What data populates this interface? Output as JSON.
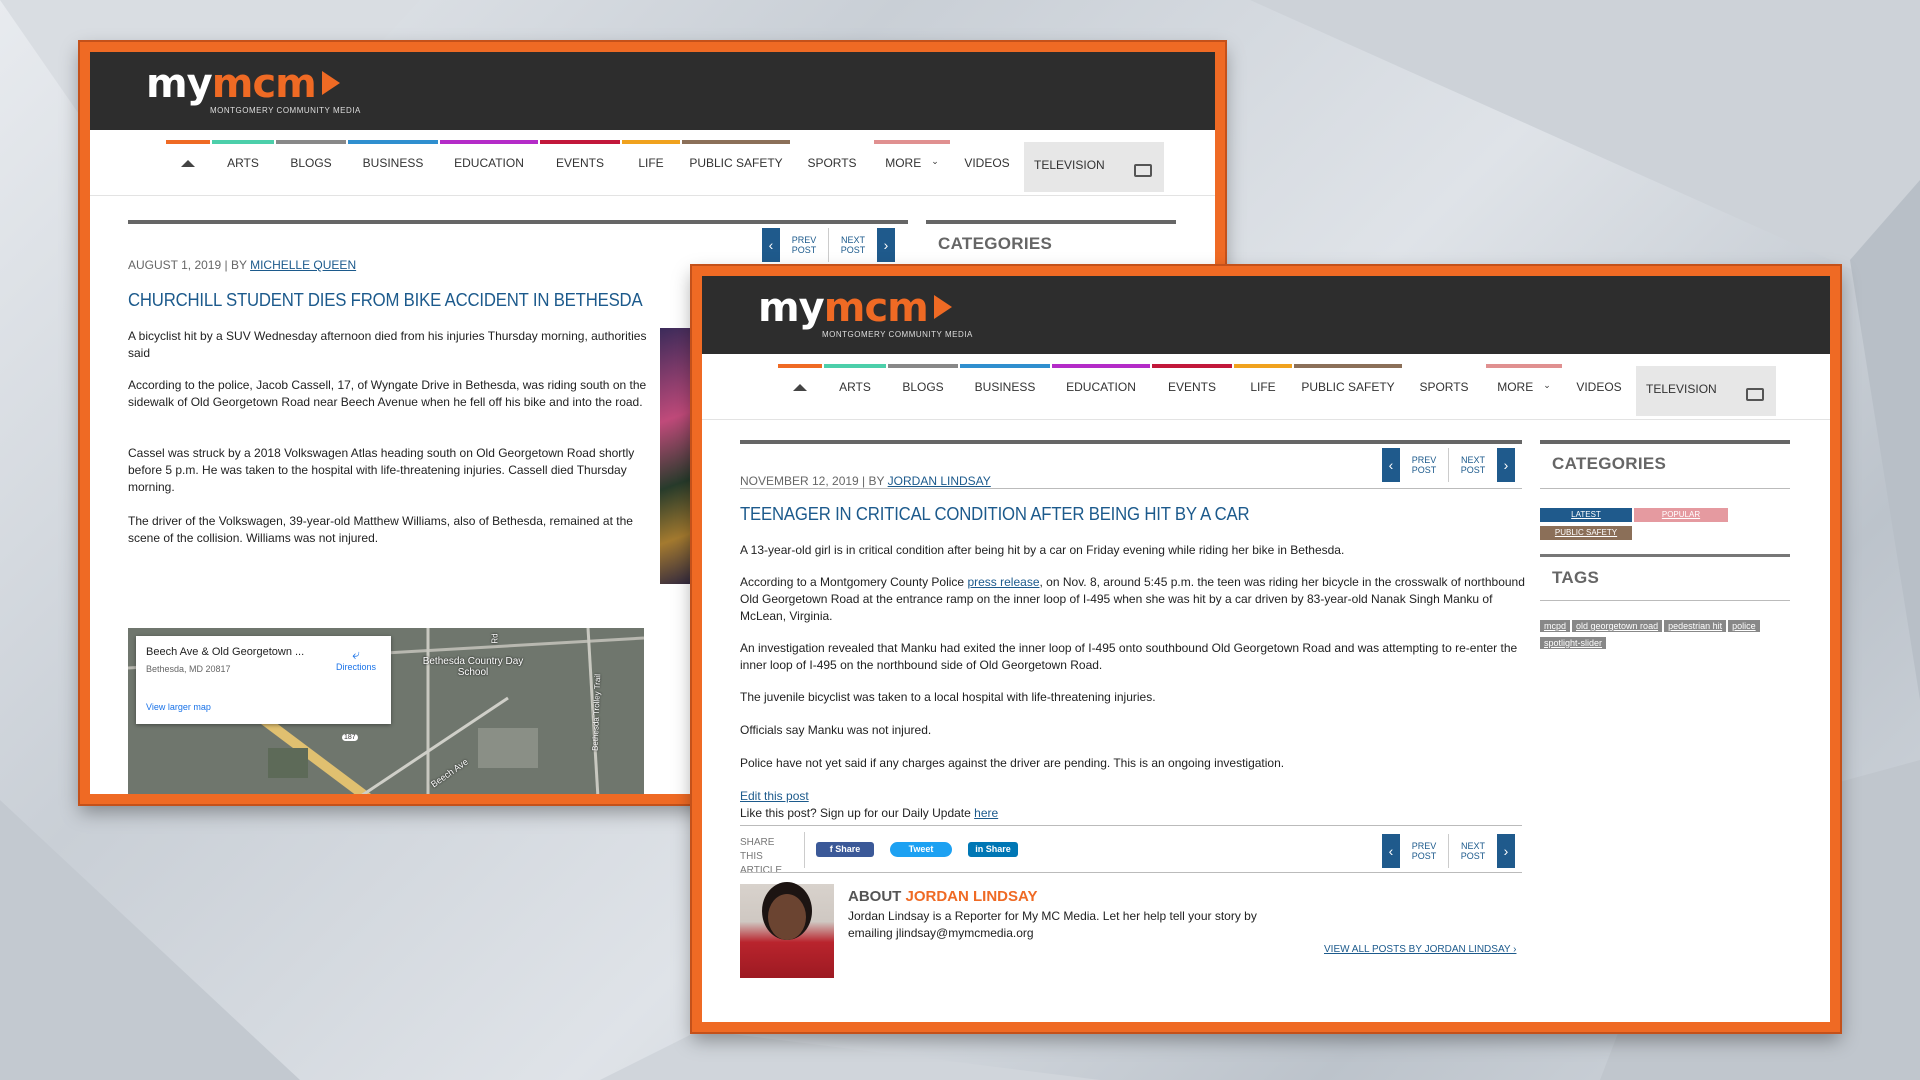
{
  "brand": {
    "my": "my",
    "mcm": "mcm",
    "tagline": "MONTGOMERY COMMUNITY MEDIA"
  },
  "nav": {
    "items": [
      "ARTS",
      "BLOGS",
      "BUSINESS",
      "EDUCATION",
      "EVENTS",
      "LIFE",
      "PUBLIC SAFETY",
      "SPORTS",
      "MORE",
      "VIDEOS",
      "TELEVISION"
    ],
    "colors": [
      "#ef6a24",
      "#4ccfaa",
      "#888888",
      "#2f8fcf",
      "#b42bc8",
      "#c2183a",
      "#f0a21e",
      "#8b6f58",
      "#777777",
      "#e09090",
      "#ffffff"
    ]
  },
  "post_nav": {
    "prev": "PREV POST",
    "next": "NEXT POST"
  },
  "sidebar": {
    "categories_title": "CATEGORIES",
    "tags_title": "TAGS",
    "cat_chips": [
      "LATEST",
      "POPULAR",
      "PUBLIC SAFETY"
    ],
    "tags": [
      "mcpd",
      "old georgetown road",
      "pedestrian hit",
      "police",
      "spotlight-slider"
    ]
  },
  "back_article": {
    "date": "AUGUST 1, 2019 | BY",
    "author": "MICHELLE QUEEN",
    "title": "CHURCHILL STUDENT DIES FROM BIKE ACCIDENT IN BETHESDA",
    "paragraphs": [
      "A bicyclist hit by a SUV Wednesday afternoon died from his injuries Thursday morning, authorities said",
      "According to the police, Jacob Cassell, 17, of Wyngate Drive in Bethesda, was riding south on the sidewalk of Old Georgetown Road near Beech Avenue when he fell off his bike and into the road.",
      "Cassel was struck by a 2018 Volkswagen Atlas heading south on Old Georgetown Road shortly before 5 p.m. He was taken to the hospital with life-threatening injuries. Cassell died Thursday morning.",
      "The driver of the Volkswagen, 39-year-old Matthew Williams, also of Bethesda, remained at the scene of the collision. Williams was not injured."
    ],
    "map": {
      "place": "Beech Ave & Old Georgetown ...",
      "address": "Bethesda, MD 20817",
      "directions": "Directions",
      "larger": "View larger map",
      "label_school": "Bethesda Country Day School",
      "label_street": "Beech Ave",
      "label_route": "187",
      "label_trail": "Bethesda Trolley Trail",
      "label_rd": "Rd"
    }
  },
  "front_article": {
    "date": "NOVEMBER 12, 2019 | BY",
    "author": "JORDAN LINDSAY",
    "title": "TEENAGER IN CRITICAL CONDITION AFTER BEING HIT BY A CAR",
    "p1": "A 13-year-old girl is in critical condition after being hit by a car on Friday evening while riding her bike in Bethesda.",
    "p2a": "According to a Montgomery County Police ",
    "p2link": "press release",
    "p2b": ", on Nov. 8, around 5:45 p.m. the teen was riding her bicycle in the crosswalk of northbound Old Georgetown Road at the entrance ramp on the inner loop of I-495 when she was hit by a car driven by 83-year-old Nanak Singh Manku of McLean, Virginia.",
    "p3": "An investigation revealed that Manku had exited the inner loop of I-495 onto southbound Old Georgetown Road and was attempting to re-enter the inner loop of I-495 on the northbound side of Old Georgetown Road.",
    "p4": "The juvenile bicyclist was taken to a local hospital with life-threatening injuries.",
    "p5": "Officials say Manku was not injured.",
    "p6": "Police have not yet said if any charges against the driver are pending. This is an ongoing investigation.",
    "edit": "Edit this post",
    "like_text": "Like this post? Sign up for our Daily Update ",
    "like_link": "here",
    "share_label": "SHARE THIS ARTICLE",
    "share_fb": "f  Share",
    "share_tw": "Tweet",
    "share_in": "in Share",
    "about_prefix": "ABOUT ",
    "about_name": "JORDAN LINDSAY",
    "bio": "Jordan Lindsay is a Reporter for My MC Media. Let her help tell your story by emailing jlindsay@mymcmedia.org",
    "view_all": "VIEW ALL POSTS BY JORDAN LINDSAY ›"
  }
}
